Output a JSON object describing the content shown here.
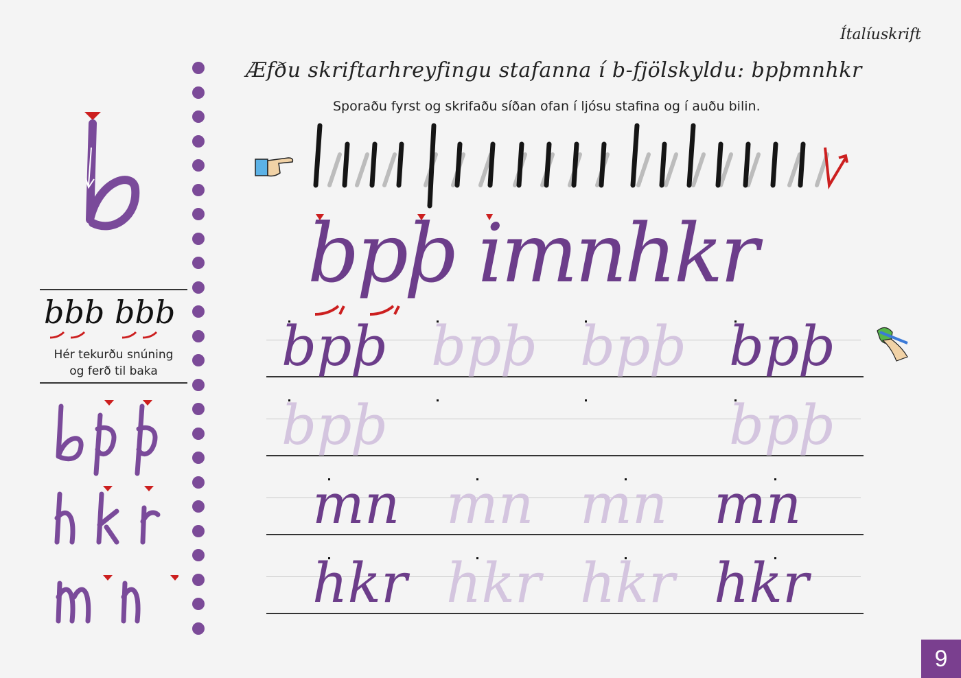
{
  "header": {
    "tag": "Ítalíuskrift"
  },
  "title": "Æfðu skriftarhreyfingu stafanna í b-fjölskyldu: bpþmnhkr",
  "subtitle": "Sporaðu fyrst og skrifaðu síðan ofan í ljósu stafina og í auðu bilin.",
  "left_panel": {
    "sample": "bbb bbb",
    "note_line1": "Hér tekurðu snúning",
    "note_line2": "og ferð til baka"
  },
  "model_row": "bpþ imnhkr",
  "practice_rows": [
    {
      "dark": "bpþ",
      "light": "bpþ",
      "end": "bpþ"
    },
    {
      "dark": "bpþ",
      "light": "",
      "end": "bpþ"
    },
    {
      "dark": "mn",
      "light": "mn",
      "end": "mn"
    },
    {
      "dark": "hkr",
      "light": "hkr",
      "end": "hkr"
    }
  ],
  "page_number": "9",
  "colors": {
    "accent": "#7a3f8f",
    "letter": "#6c3d8a",
    "light_letter": "#d4c5df",
    "arrow_red": "#cc1f1f"
  }
}
